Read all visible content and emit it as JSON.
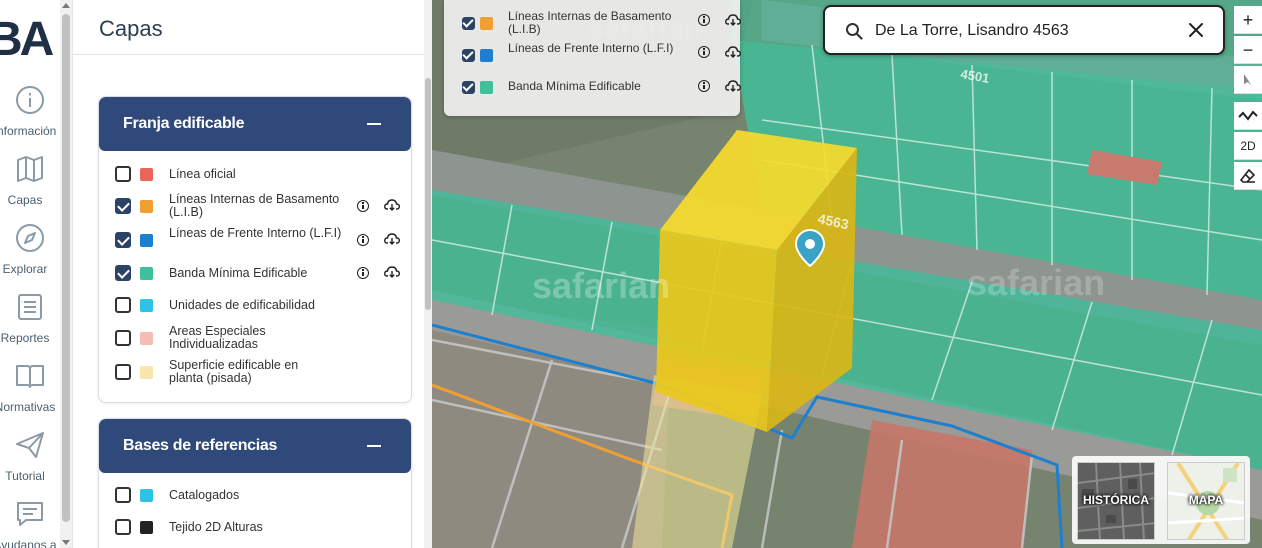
{
  "rail": {
    "logo_text": "BA",
    "items": [
      {
        "label": "Información"
      },
      {
        "label": "Capas"
      },
      {
        "label": "Explorar"
      },
      {
        "label": "Reportes"
      },
      {
        "label": "Normativas"
      },
      {
        "label": "Tutorial"
      },
      {
        "label": "Ayudanos a"
      }
    ]
  },
  "panel": {
    "title": "Capas",
    "sections": [
      {
        "title": "Franja edificable",
        "items": [
          {
            "label": "Línea oficial",
            "checked": false,
            "color": "#e9675a"
          },
          {
            "label": "Líneas Internas de Basamento (L.I.B)",
            "checked": true,
            "color": "#f0a033"
          },
          {
            "label": "Líneas de Frente Interno (L.F.I)",
            "checked": true,
            "color": "#1f7fcf"
          },
          {
            "label": "Banda Mínima Edificable",
            "checked": true,
            "color": "#3fbf9a"
          },
          {
            "label": "Unidades de edificabilidad",
            "checked": false,
            "color": "#2ec3e6"
          },
          {
            "label": "Areas Especiales Individualizadas",
            "checked": false,
            "color": "#f4bcb5"
          },
          {
            "label": "Superficie edificable en planta (pisada)",
            "checked": false,
            "color": "#f8e6ad"
          }
        ]
      },
      {
        "title": "Bases de referencias",
        "items": [
          {
            "label": "Catalogados",
            "checked": false,
            "color": "#2ec3e6"
          },
          {
            "label": "Tejido 2D Alturas",
            "checked": false,
            "color": "#222222"
          }
        ]
      }
    ]
  },
  "map": {
    "legend": [
      {
        "label": "Líneas Internas de Basamento (L.I.B)",
        "checked": true,
        "color": "#f0a033"
      },
      {
        "label": "Líneas de Frente Interno (L.F.I)",
        "checked": true,
        "color": "#1f7fcf"
      },
      {
        "label": "Banda Mínima Edificable",
        "checked": true,
        "color": "#3fbf9a"
      }
    ],
    "search": {
      "value": "De La Torre, Lisandro 4563"
    },
    "controls": {
      "zoom_in": "+",
      "zoom_out": "−",
      "mode": "2D"
    },
    "street_numbers": [
      "4501",
      "4563"
    ],
    "watermark": "safarian",
    "basemaps": [
      {
        "label": "HISTÓRICA"
      },
      {
        "label": "MAPA"
      }
    ]
  }
}
